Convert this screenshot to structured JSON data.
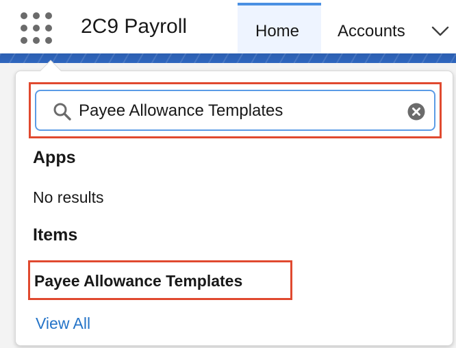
{
  "header": {
    "app_name": "2C9 Payroll",
    "tabs": [
      {
        "label": "Home",
        "active": true
      },
      {
        "label": "Accounts",
        "active": false
      }
    ]
  },
  "search": {
    "value": "Payee Allowance Templates",
    "placeholder": "",
    "search_icon": "search-icon",
    "clear_icon": "clear-icon"
  },
  "results": {
    "apps_heading": "Apps",
    "apps_empty": "No results",
    "items_heading": "Items",
    "items": [
      {
        "label": "Payee Allowance Templates"
      }
    ],
    "view_all": "View All"
  },
  "icons": {
    "app_launcher": "app-launcher-grid-icon",
    "tab_menu": "chevron-down-icon"
  },
  "colors": {
    "tab_active_bg": "#eef4ff",
    "tab_active_indicator": "#4a90e2",
    "search_focus_border": "#5a9be6",
    "highlight_border": "#e0492f",
    "link": "#2574c8",
    "brand_band": "#2c5fb1"
  }
}
